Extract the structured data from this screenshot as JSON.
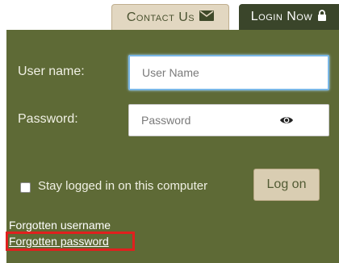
{
  "tabs": {
    "contact_label": "Contact Us",
    "login_label": "Login Now"
  },
  "form": {
    "username_label": "User name:",
    "username_placeholder": "User Name",
    "password_label": "Password:",
    "password_placeholder": "Password",
    "stay_logged_in_label": "Stay logged in on this computer",
    "stay_logged_in_checked": false,
    "logon_label": "Log on"
  },
  "links": {
    "forgotten_username": "Forgotten username",
    "forgotten_password": "Forgotten password"
  },
  "colors": {
    "panel_bg": "#5e6a36",
    "highlight": "#e0201e",
    "contact_tab_bg": "#e2d7c1",
    "login_tab_bg": "#3a452a"
  },
  "icons": {
    "contact": "envelope-icon",
    "login": "lock-icon",
    "password_toggle": "eye-icon"
  }
}
